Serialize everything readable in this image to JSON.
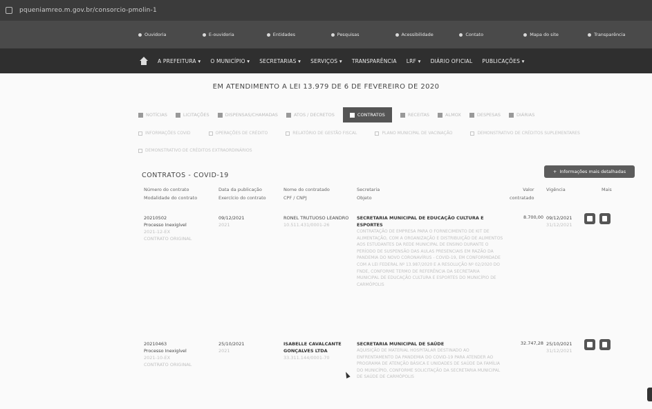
{
  "browser": {
    "url": "pqueniamreo.m.gov.br/consorcio-pmolin-1"
  },
  "top_links": [
    "Ouvidoria",
    "E-ouvidoria",
    "Entidades",
    "Pesquisas",
    "Acessibilidade",
    "Contato",
    "Mapa do site",
    "Transparência"
  ],
  "nav": {
    "items": [
      "A PREFEITURA ▾",
      "O MUNICÍPIO ▾",
      "SECRETARIAS ▾",
      "SERVIÇOS ▾",
      "TRANSPARÊNCIA",
      "LRF ▾",
      "DIÁRIO OFICIAL",
      "PUBLICAÇÕES ▾"
    ]
  },
  "notice": "EM ATENDIMENTO A LEI 13.979 DE 6 DE FEVEREIRO DE 2020",
  "tabs": [
    {
      "label": "NOTÍCIAS",
      "active": false
    },
    {
      "label": "LICITAÇÕES",
      "active": false
    },
    {
      "label": "DISPENSAS/CHAMADAS",
      "active": false
    },
    {
      "label": "ATOS / DECRETOS",
      "active": false
    },
    {
      "label": "CONTRATOS",
      "active": true
    },
    {
      "label": "RECEITAS",
      "active": false
    },
    {
      "label": "ALMOX",
      "active": false
    },
    {
      "label": "DESPESAS",
      "active": false
    },
    {
      "label": "DIÁRIAS",
      "active": false
    }
  ],
  "sublinks": [
    "INFORMAÇÕES COVID",
    "OPERAÇÕES DE CRÉDITO",
    "RELATÓRIO DE GESTÃO FISCAL",
    "PLANO MUNICIPAL DE VACINAÇÃO",
    "DEMONSTRATIVO DE CRÉDITOS SUPLEMENTARES",
    "DEMONSTRATIVO DE CRÉDITOS EXTRAORDINÁRIOS"
  ],
  "section": {
    "title": "CONTRATOS - COVID-19",
    "info_button": "Informações mais detalhadas"
  },
  "columns": {
    "numero": [
      "Número do contrato",
      "Modalidade do contrato"
    ],
    "data": [
      "Data da publicação",
      "Exercício do contrato"
    ],
    "nome": [
      "Nome do contratado",
      "CPF / CNPJ"
    ],
    "secretaria": [
      "Secretaria",
      "Objeto"
    ],
    "valor": [
      "Valor",
      "contratado"
    ],
    "vigencia": [
      "Vigência"
    ],
    "mais": [
      "Mais"
    ]
  },
  "rows": [
    {
      "numero": "20210502",
      "modalidade": "Processo Inexigível",
      "tipo1": "2021-12-EX",
      "tipo2": "CONTRATO ORIGINAL",
      "data": "09/12/2021",
      "exercicio": "2021",
      "nome": "RONEL TRUTUOSO LEANDRO",
      "doc": "10.511.431/0001-26",
      "secretaria": "SECRETARIA MUNICIPAL DE EDUCAÇÃO CULTURA E ESPORTES",
      "objeto": "CONTRATAÇÃO DE EMPRESA PARA O FORNECIMENTO DE KIT DE ALIMENTAÇÃO, COM A ORGANIZAÇÃO E DISTRIBUIÇÃO DE ALIMENTOS AOS ESTUDANTES DA REDE MUNICIPAL DE ENSINO DURANTE O PERÍODO DE SUSPENSÃO DAS AULAS PRESENCIAIS EM RAZÃO DA PANDEMIA DO NOVO CORONAVÍRUS - COVID-19, EM CONFORMIDADE COM A LEI FEDERAL Nº 13.987/2020 E A RESOLUÇÃO Nº 02/2020 DO FNDE, CONFORME TERMO DE REFERÊNCIA DA SECRETARIA MUNICIPAL DE EDUCAÇÃO CULTURA E ESPORTES DO MUNICÍPIO DE CARMÓPOLIS",
      "valor": "8.700,00",
      "vig1": "09/12/2021",
      "vig2": "31/12/2021"
    },
    {
      "numero": "20210463",
      "modalidade": "Processo Inexigível",
      "tipo1": "2021-10-EX",
      "tipo2": "CONTRATO ORIGINAL",
      "data": "25/10/2021",
      "exercicio": "2021",
      "nome": "ISABELLE CAVALCANTE GONÇALVES LTDA",
      "doc": "33.311.144/0001-70",
      "secretaria": "SECRETARIA MUNICIPAL DE SAÚDE",
      "objeto": "AQUISIÇÃO DE MATERIAL HOSPITALAR DESTINADO AO ENFRENTAMENTO DA PANDEMIA DO COVID-19 PARA ATENDER AO PROGRAMA DE ATENÇÃO BÁSICA E UNIDADES DE SAÚDE DA FAMÍLIA DO MUNICÍPIO, CONFORME SOLICITAÇÃO DA SECRETARIA MUNICIPAL DE SAÚDE DE CARMÓPOLIS",
      "valor": "32.747,28",
      "vig1": "25/10/2021",
      "vig2": "31/12/2021"
    }
  ]
}
